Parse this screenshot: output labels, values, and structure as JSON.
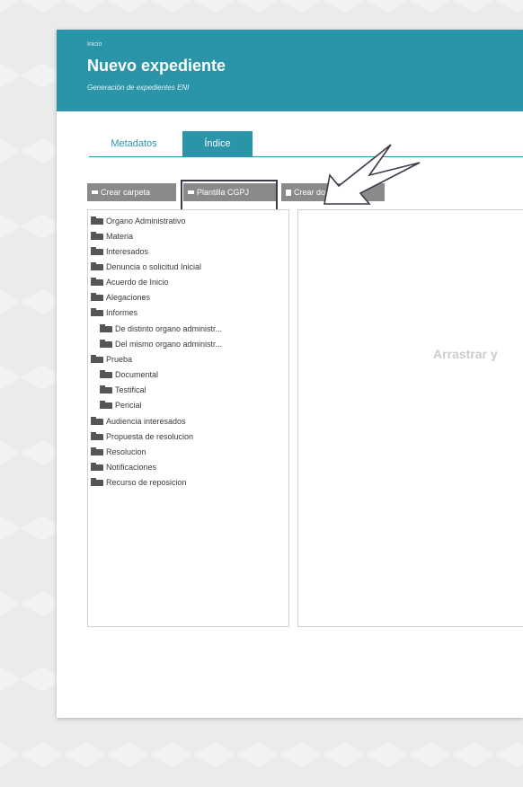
{
  "header": {
    "breadcrumb": "Inicio",
    "title": "Nuevo expediente",
    "subtitle": "Generación de expedientes ENI"
  },
  "tabs": [
    {
      "label": "Metadatos",
      "active": false
    },
    {
      "label": "Índice",
      "active": true
    }
  ],
  "toolbar": {
    "create_folder": "Crear carpeta",
    "template": "Plantilla CGPJ",
    "create_document": "Crear documento"
  },
  "tree": [
    {
      "label": "Organo Administrativo",
      "level": 0
    },
    {
      "label": "Materia",
      "level": 0
    },
    {
      "label": "Interesados",
      "level": 0
    },
    {
      "label": "Denuncia o solicitud Inicial",
      "level": 0
    },
    {
      "label": "Acuerdo de Inicio",
      "level": 0
    },
    {
      "label": "Alegaciones",
      "level": 0
    },
    {
      "label": "Informes",
      "level": 0
    },
    {
      "label": "De distinto organo administr...",
      "level": 1
    },
    {
      "label": "Del mismo organo administr...",
      "level": 1
    },
    {
      "label": "Prueba",
      "level": 0
    },
    {
      "label": "Documental",
      "level": 1
    },
    {
      "label": "Testifical",
      "level": 1
    },
    {
      "label": "Pericial",
      "level": 1
    },
    {
      "label": "Audiencia interesados",
      "level": 0
    },
    {
      "label": "Propuesta de resolucion",
      "level": 0
    },
    {
      "label": "Resolucion",
      "level": 0
    },
    {
      "label": "Notificaciones",
      "level": 0
    },
    {
      "label": "Recurso de reposicion",
      "level": 0
    }
  ],
  "drop_zone": {
    "text": "Arrastrar y"
  },
  "colors": {
    "accent": "#2a95a8",
    "button": "#8a8a8a",
    "folder": "#555555"
  }
}
